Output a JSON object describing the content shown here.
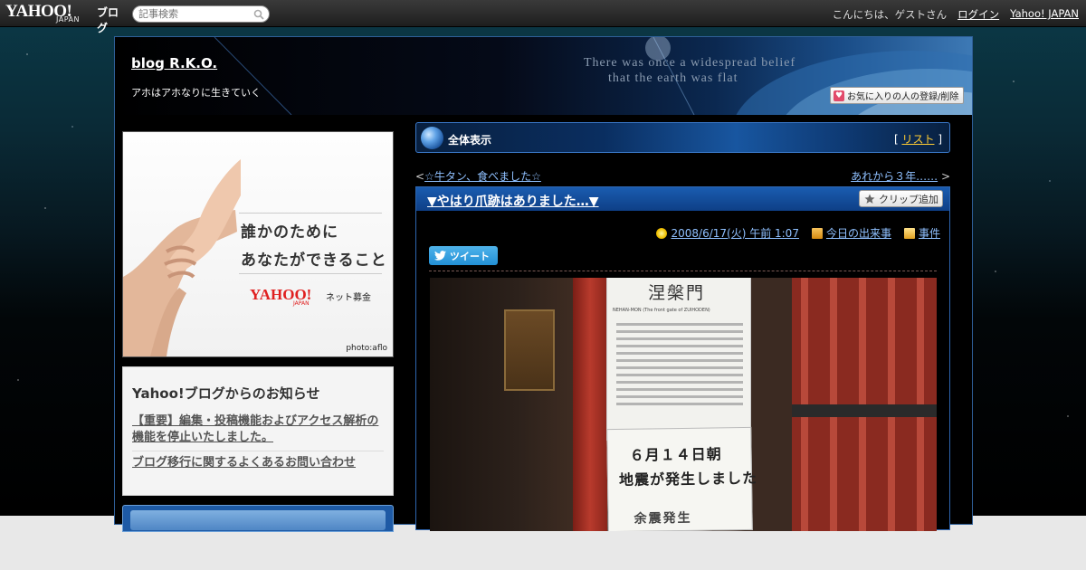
{
  "masthead": {
    "logo_main": "YAHOO!",
    "logo_sub": "JAPAN",
    "logo_blog": "ブログ",
    "search_placeholder": "記事検索",
    "greeting": "こんにちは、ゲストさん",
    "login_label": "ログイン",
    "yahoo_japan_label": "Yahoo! JAPAN"
  },
  "banner": {
    "blog_title": "blog R.K.O.",
    "blog_description": "アホはアホなりに生きていく",
    "quote": "There was once a widespread belief\n      that the earth was flat",
    "favorite_button_label": "お気に入りの人の登録/削除"
  },
  "ad": {
    "line1": "誰かのために",
    "line2": "あなたができること",
    "logo": "YAHOO!",
    "logo_sub": "JAPAN",
    "logo_side": "ネット募金",
    "credit": "photo:aflo"
  },
  "notice": {
    "title": "Yahoo!ブログからのお知らせ",
    "items": [
      "【重要】編集・投稿機能およびアクセス解析の機能を停止いたしました。",
      "ブログ移行に関するよくあるお問い合わせ"
    ]
  },
  "list_header": {
    "title": "全体表示",
    "bracket_open": "[",
    "list_link": "リスト",
    "bracket_close": "]"
  },
  "navigation": {
    "prev_prefix": "<",
    "prev_label": "☆牛タン、食べました☆",
    "next_label": "あれから３年……",
    "next_suffix": ">"
  },
  "post": {
    "title": "▼やはり爪跡はありました…▼",
    "clip_button_label": "クリップ追加",
    "datetime": "2008/6/17(火) 午前 1:07",
    "today_events_label": "今日の出来事",
    "category": "事件",
    "tweet_label": "ツイート",
    "photo": {
      "sign_title": "涅槃門",
      "sign_subtitle": "NEHAN-MON (The front gate of ZUIHODEN)",
      "notice_line1": "６月１４日朝",
      "notice_line2": "地震が発生しました",
      "notice_line3": "余震発生"
    }
  },
  "colors": {
    "accent_link": "#8fc0ff",
    "list_link": "#ffcc33",
    "title_bar": "#1a5cb0",
    "frame_border": "#2f5f98"
  }
}
